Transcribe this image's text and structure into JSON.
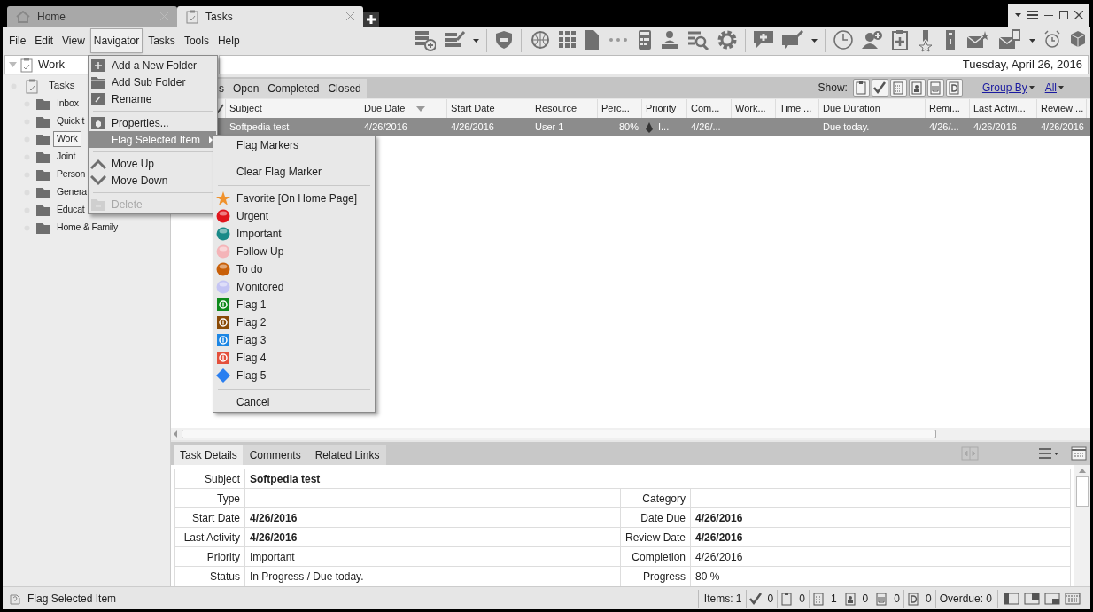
{
  "tabs": [
    {
      "label": "Home",
      "selected": false
    },
    {
      "label": "Tasks",
      "selected": true
    }
  ],
  "menu_bar": [
    {
      "label": "File",
      "selected": false
    },
    {
      "label": "Edit",
      "selected": false
    },
    {
      "label": "View",
      "selected": false
    },
    {
      "label": "Navigator",
      "selected": true
    },
    {
      "label": "Tasks",
      "selected": false
    },
    {
      "label": "Tools",
      "selected": false
    },
    {
      "label": "Help",
      "selected": false
    }
  ],
  "navigator": {
    "label": "Work"
  },
  "date": "Tuesday, April 26, 2016",
  "tree": {
    "label": "Tasks",
    "children": [
      {
        "label": "Inbox",
        "selected": false
      },
      {
        "label": "Quick t",
        "selected": false
      },
      {
        "label": "Work",
        "selected": true
      },
      {
        "label": "Joint",
        "selected": false
      },
      {
        "label": "Person",
        "selected": false
      },
      {
        "label": "Genera",
        "selected": false
      },
      {
        "label": "Educat",
        "selected": false
      },
      {
        "label": "Home & Family",
        "selected": false
      }
    ]
  },
  "filter_tabs": [
    "s",
    "Open",
    "Completed",
    "Closed"
  ],
  "show": {
    "label": "Show:",
    "group_by": "Group By",
    "filter": "All"
  },
  "grid": {
    "columns": [
      {
        "label": "Subject",
        "kind": "text",
        "sorted": false
      },
      {
        "label": "Due Date",
        "kind": "text",
        "sorted": true
      },
      {
        "label": "Start Date",
        "kind": "text",
        "sorted": false
      },
      {
        "label": "Resource",
        "kind": "text",
        "sorted": false
      },
      {
        "label": "Perc...",
        "kind": "number",
        "sorted": false
      },
      {
        "label": "Priority",
        "kind": "priority",
        "sorted": false
      },
      {
        "label": "Com...",
        "kind": "text",
        "sorted": false
      },
      {
        "label": "Work...",
        "kind": "text",
        "sorted": false
      },
      {
        "label": "Time ...",
        "kind": "text",
        "sorted": false
      },
      {
        "label": "Due Duration",
        "kind": "text",
        "sorted": false
      },
      {
        "label": "Remi...",
        "kind": "text",
        "sorted": false
      },
      {
        "label": "Last Activi...",
        "kind": "text",
        "sorted": false
      },
      {
        "label": "Review ...",
        "kind": "text",
        "sorted": false
      }
    ],
    "rows": [
      {
        "selected": true,
        "cells": [
          "Softpedia test",
          "4/26/2016",
          "4/26/2016",
          "User 1",
          "80%",
          "I...",
          "4/26/...",
          null,
          null,
          "Due today.",
          "4/26/...",
          "4/26/2016",
          "4/26/2016"
        ]
      }
    ]
  },
  "details": {
    "tabs": [
      {
        "label": "Task Details",
        "selected": true
      },
      {
        "label": "Comments",
        "selected": false
      },
      {
        "label": "Related Links",
        "selected": false
      }
    ],
    "subject": {
      "label": "Subject",
      "value": "Softpedia test",
      "bold": true
    },
    "rows": [
      [
        {
          "label": "Type"
        },
        {
          "label": "Category"
        }
      ],
      [
        {
          "label": "Start Date",
          "value": "4/26/2016",
          "bold": true
        },
        {
          "label": "Date Due",
          "value": "4/26/2016",
          "bold": true
        }
      ],
      [
        {
          "label": "Last Activity",
          "value": "4/26/2016",
          "bold": true
        },
        {
          "label": "Review Date",
          "value": "4/26/2016",
          "bold": true
        }
      ],
      [
        {
          "label": "Priority",
          "value": "Important",
          "bold": false
        },
        {
          "label": "Completion",
          "value": "4/26/2016",
          "bold": false
        }
      ],
      [
        {
          "label": "Status",
          "value": "In Progress / Due today.",
          "bold": false
        },
        {
          "label": "Progress",
          "value": "80 %",
          "bold": false
        }
      ]
    ]
  },
  "navigator_menu": [
    {
      "kind": "item",
      "label": "Add a New Folder",
      "selected": false,
      "disabled": false,
      "submenu": false
    },
    {
      "kind": "item",
      "label": "Add Sub Folder",
      "selected": false,
      "disabled": false,
      "submenu": false
    },
    {
      "kind": "item",
      "label": "Rename",
      "selected": false,
      "disabled": false,
      "submenu": false
    },
    {
      "kind": "separator"
    },
    {
      "kind": "item",
      "label": "Properties...",
      "selected": false,
      "disabled": false,
      "submenu": false
    },
    {
      "kind": "item",
      "label": "Flag Selected Item",
      "selected": true,
      "disabled": false,
      "submenu": true
    },
    {
      "kind": "separator"
    },
    {
      "kind": "item",
      "label": "Move Up",
      "selected": false,
      "disabled": false,
      "submenu": false
    },
    {
      "kind": "item",
      "label": "Move Down",
      "selected": false,
      "disabled": false,
      "submenu": false
    },
    {
      "kind": "separator"
    },
    {
      "kind": "item",
      "label": "Delete",
      "selected": false,
      "disabled": true,
      "submenu": false
    }
  ],
  "flag_menu": [
    {
      "kind": "text",
      "label": "Flag Markers"
    },
    {
      "kind": "separator"
    },
    {
      "kind": "text",
      "label": "Clear Flag Marker"
    },
    {
      "kind": "separator"
    },
    {
      "kind": "star",
      "label": "Favorite [On Home Page]",
      "color": "#f0922c"
    },
    {
      "kind": "ball",
      "label": "Urgent",
      "color": "#e0141c"
    },
    {
      "kind": "ball",
      "label": "Important",
      "color": "#1a8a88"
    },
    {
      "kind": "ball",
      "label": "Follow Up",
      "color": "#f4b4b8"
    },
    {
      "kind": "ball",
      "label": "To do",
      "color": "#c85f08"
    },
    {
      "kind": "ball",
      "label": "Monitored",
      "color": "#c4c4f4"
    },
    {
      "kind": "flag",
      "label": "Flag 1",
      "color": "#0f8a1c"
    },
    {
      "kind": "flag",
      "label": "Flag 2",
      "color": "#8a4a06"
    },
    {
      "kind": "flag",
      "label": "Flag 3",
      "color": "#1c86e4"
    },
    {
      "kind": "flag",
      "label": "Flag 4",
      "color": "#e4503c"
    },
    {
      "kind": "diamond",
      "label": "Flag 5",
      "color": "#2a7ff0"
    },
    {
      "kind": "separator"
    },
    {
      "kind": "text",
      "label": "Cancel"
    }
  ],
  "status_bar": {
    "message": "Flag Selected Item",
    "items": "Items: 1",
    "counts": [
      "0",
      "0",
      "1",
      "0",
      "0",
      "0"
    ],
    "overdue": "Overdue: 0"
  }
}
